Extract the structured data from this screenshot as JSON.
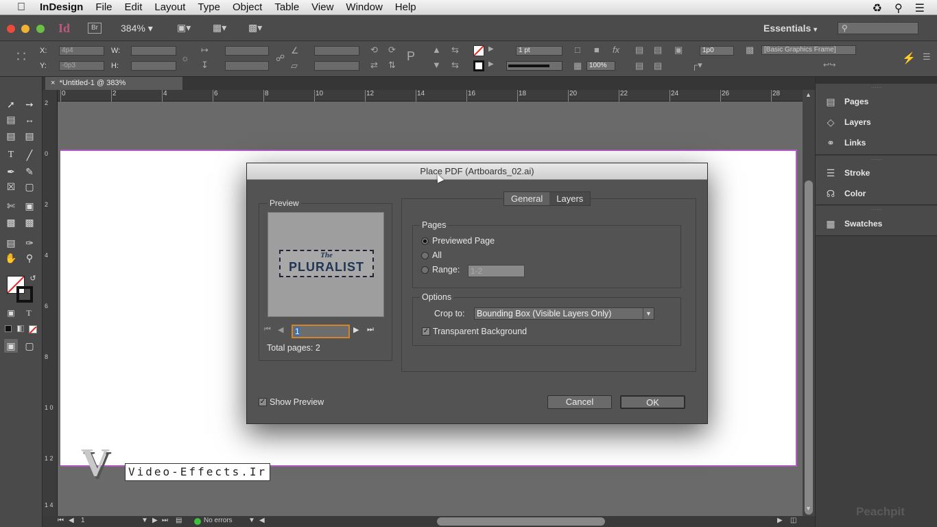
{
  "menubar": {
    "apple_icon": "apple-icon",
    "app_name": "InDesign",
    "items": [
      "File",
      "Edit",
      "Layout",
      "Type",
      "Object",
      "Table",
      "View",
      "Window",
      "Help"
    ]
  },
  "appbar": {
    "app_logo": "Id",
    "bridge_label": "Br",
    "zoom": "384%",
    "workspace": "Essentials",
    "search_placeholder": ""
  },
  "control_panel": {
    "x_label": "X:",
    "x_value": "4p4",
    "y_label": "Y:",
    "y_value": "-0p3",
    "w_label": "W:",
    "h_label": "H:",
    "stroke_weight": "1 pt",
    "opacity": "100%",
    "gap": "1p0",
    "object_style": "[Basic Graphics Frame]"
  },
  "document": {
    "tab_title": "*Untitled-1 @ 383%",
    "ruler_h": [
      "0",
      "2",
      "4",
      "6",
      "8",
      "10",
      "12",
      "14",
      "16",
      "18",
      "20",
      "22",
      "24",
      "26",
      "28"
    ],
    "ruler_v": [
      "2",
      "0",
      "2",
      "4",
      "6",
      "8",
      "1 0",
      "1 2",
      "1 4"
    ]
  },
  "status": {
    "page": "1",
    "errors": "No errors"
  },
  "panels": {
    "group1": [
      "Pages",
      "Layers",
      "Links"
    ],
    "group2": [
      "Stroke",
      "Color"
    ],
    "group3": [
      "Swatches"
    ],
    "brand": "Peachpit"
  },
  "watermark": {
    "letter": "V",
    "text": "Video-Effects.Ir"
  },
  "dialog": {
    "title": "Place PDF (Artboards_02.ai)",
    "preview_label": "Preview",
    "preview_logo_top": "The",
    "preview_logo_main": "PLURALIST",
    "page_field": "1",
    "total_pages": "Total pages: 2",
    "tabs": [
      "General",
      "Layers"
    ],
    "pages_label": "Pages",
    "pages_options": [
      "Previewed Page",
      "All",
      "Range:"
    ],
    "range_value": "1-2",
    "options_label": "Options",
    "crop_label": "Crop to:",
    "crop_value": "Bounding Box (Visible Layers Only)",
    "transparent_bg": "Transparent Background",
    "show_preview": "Show Preview",
    "cancel": "Cancel",
    "ok": "OK"
  }
}
